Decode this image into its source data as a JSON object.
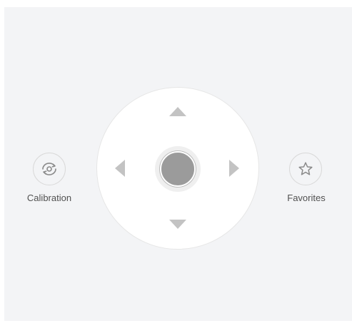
{
  "controls": {
    "calibration_label": "Calibration",
    "favorites_label": "Favorites"
  },
  "icons": {
    "calibration": "rotate-eye-icon",
    "favorites": "star-icon",
    "pan_up": "triangle-up-icon",
    "pan_down": "triangle-down-icon",
    "pan_left": "triangle-left-icon",
    "pan_right": "triangle-right-icon"
  },
  "colors": {
    "panel_background": "#f3f4f6",
    "pad_background": "#ffffff",
    "arrow": "#c3c3c3",
    "knob": "#9b9b9b",
    "label": "#505050"
  }
}
